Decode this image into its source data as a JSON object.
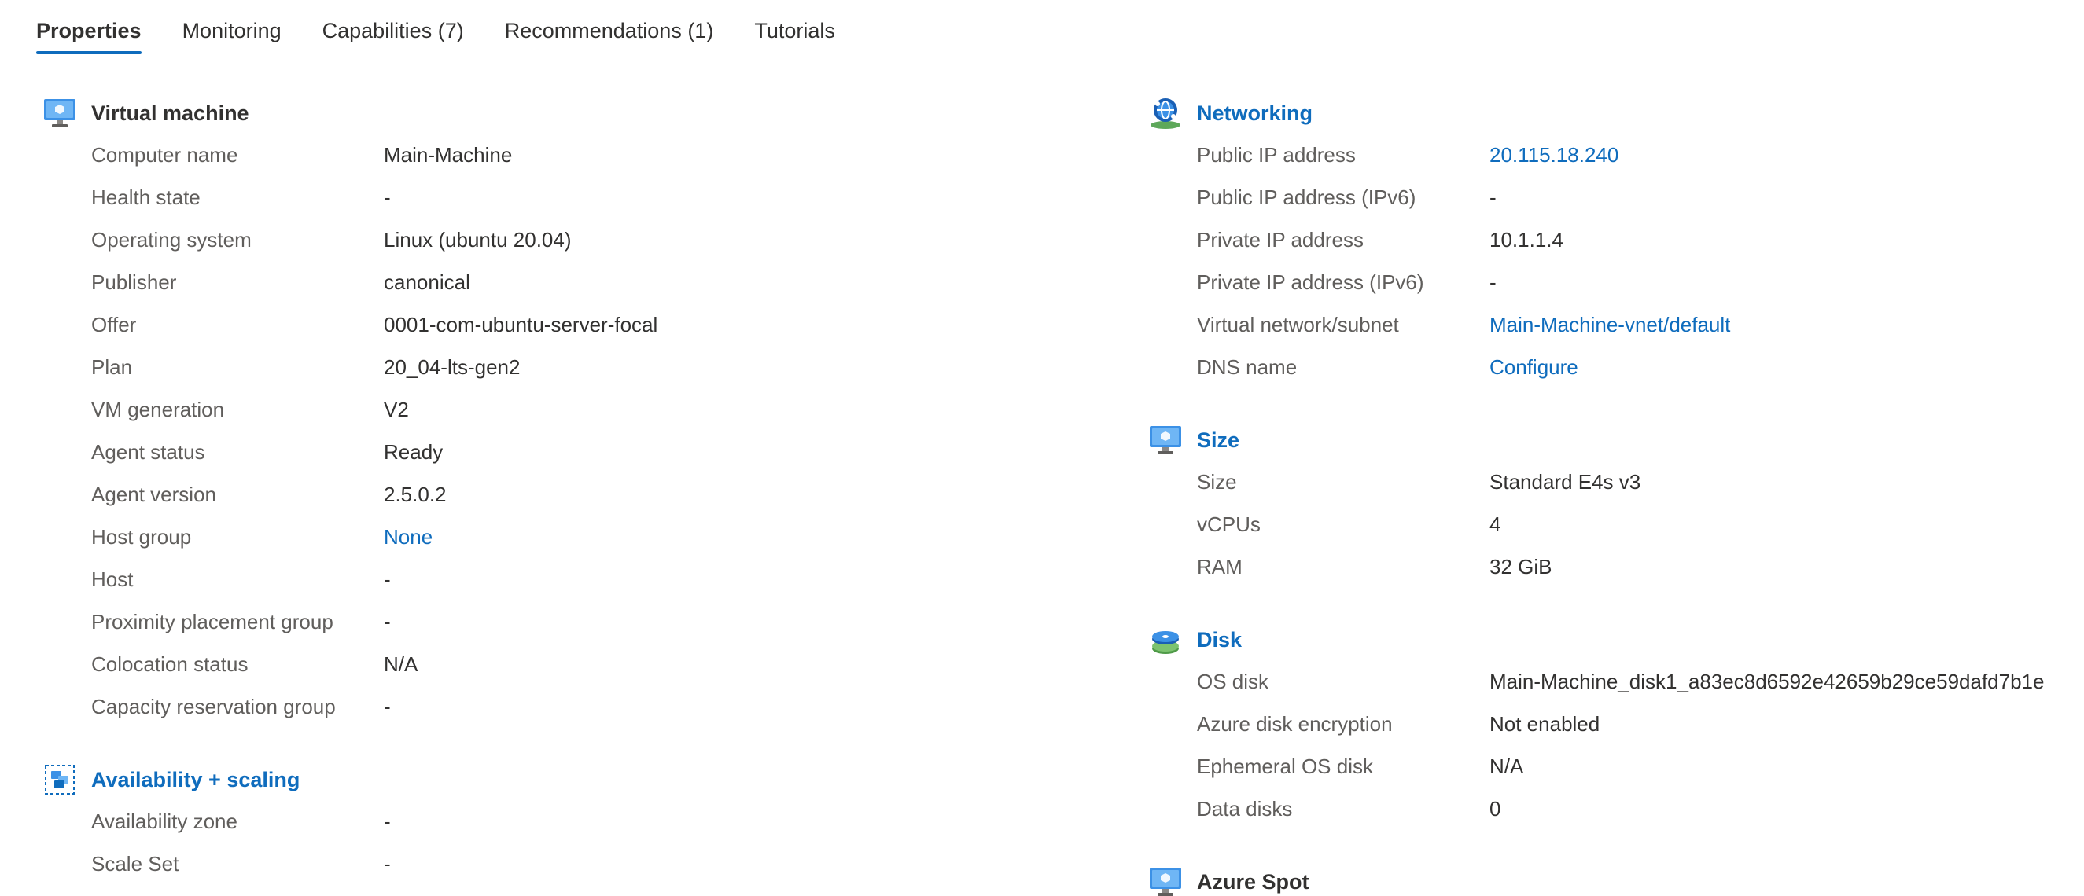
{
  "tabs": [
    {
      "label": "Properties"
    },
    {
      "label": "Monitoring"
    },
    {
      "label": "Capabilities (7)"
    },
    {
      "label": "Recommendations (1)"
    },
    {
      "label": "Tutorials"
    }
  ],
  "left": {
    "virtual_machine": {
      "title": "Virtual machine",
      "rows": [
        {
          "label": "Computer name",
          "value": "Main-Machine"
        },
        {
          "label": "Health state",
          "value": "-"
        },
        {
          "label": "Operating system",
          "value": "Linux (ubuntu 20.04)"
        },
        {
          "label": "Publisher",
          "value": "canonical"
        },
        {
          "label": "Offer",
          "value": "0001-com-ubuntu-server-focal"
        },
        {
          "label": "Plan",
          "value": "20_04-lts-gen2"
        },
        {
          "label": "VM generation",
          "value": "V2"
        },
        {
          "label": "Agent status",
          "value": "Ready"
        },
        {
          "label": "Agent version",
          "value": "2.5.0.2"
        },
        {
          "label": "Host group",
          "value": "None"
        },
        {
          "label": "Host",
          "value": "-"
        },
        {
          "label": "Proximity placement group",
          "value": "-"
        },
        {
          "label": "Colocation status",
          "value": "N/A"
        },
        {
          "label": "Capacity reservation group",
          "value": "-"
        }
      ]
    },
    "availability": {
      "title": "Availability + scaling",
      "rows": [
        {
          "label": "Availability zone",
          "value": "-"
        },
        {
          "label": "Scale Set",
          "value": "-"
        }
      ]
    }
  },
  "right": {
    "networking": {
      "title": "Networking",
      "rows": [
        {
          "label": "Public IP address",
          "value": "20.115.18.240"
        },
        {
          "label": "Public IP address (IPv6)",
          "value": "-"
        },
        {
          "label": "Private IP address",
          "value": "10.1.1.4"
        },
        {
          "label": "Private IP address (IPv6)",
          "value": "-"
        },
        {
          "label": "Virtual network/subnet",
          "value": "Main-Machine-vnet/default"
        },
        {
          "label": "DNS name",
          "value": "Configure"
        }
      ]
    },
    "size": {
      "title": "Size",
      "rows": [
        {
          "label": "Size",
          "value": "Standard E4s v3"
        },
        {
          "label": "vCPUs",
          "value": "4"
        },
        {
          "label": "RAM",
          "value": "32 GiB"
        }
      ]
    },
    "disk": {
      "title": "Disk",
      "rows": [
        {
          "label": "OS disk",
          "value": "Main-Machine_disk1_a83ec8d6592e42659b29ce59dafd7b1e"
        },
        {
          "label": "Azure disk encryption",
          "value": "Not enabled"
        },
        {
          "label": "Ephemeral OS disk",
          "value": "N/A"
        },
        {
          "label": "Data disks",
          "value": "0"
        }
      ]
    },
    "spot": {
      "title": "Azure Spot"
    }
  },
  "icons": {
    "vm": "monitor-icon",
    "availability": "scale-set-icon",
    "networking": "globe-network-icon",
    "size": "monitor-icon",
    "disk": "disk-stack-icon",
    "spot": "monitor-icon"
  },
  "colors": {
    "link": "#0f6cbd",
    "label": "#605e5c",
    "text": "#323130",
    "tab_underline": "#0f6cbd"
  }
}
